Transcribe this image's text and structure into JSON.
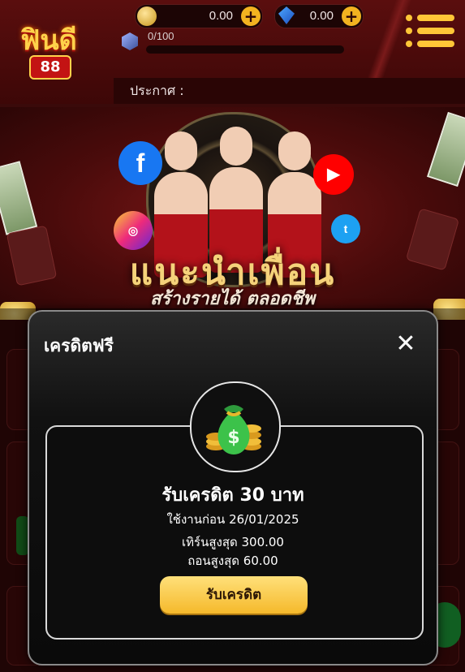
{
  "header": {
    "logo_text": "ฟินดี",
    "logo_number": "88",
    "coin_balance": "0.00",
    "gem_balance": "0.00",
    "level_progress": "0/100",
    "level_progress_fraction": 0.0,
    "announce_label": "ประกาศ :"
  },
  "banner": {
    "title": "แนะนำเพื่อน",
    "subtitle": "สร้างรายได้ ตลอดชีพ",
    "social_icons": [
      "facebook-icon",
      "instagram-icon",
      "youtube-icon",
      "twitter-icon"
    ]
  },
  "modal": {
    "title": "เครดิตฟรี",
    "close_symbol": "✕",
    "icon": "money-bag-icon",
    "credit_title": "รับเครดิต 30 บาท",
    "use_before": "ใช้งานก่อน 26/01/2025",
    "max_turnover": "เทิร์นสูงสุด 300.00",
    "max_withdraw": "ถอนสูงสุด 60.00",
    "claim_button": "รับเครดิต"
  },
  "colors": {
    "accent_gold": "#ffc637",
    "button_gold": "#f5b92b",
    "background_red": "#3a0a0a"
  }
}
